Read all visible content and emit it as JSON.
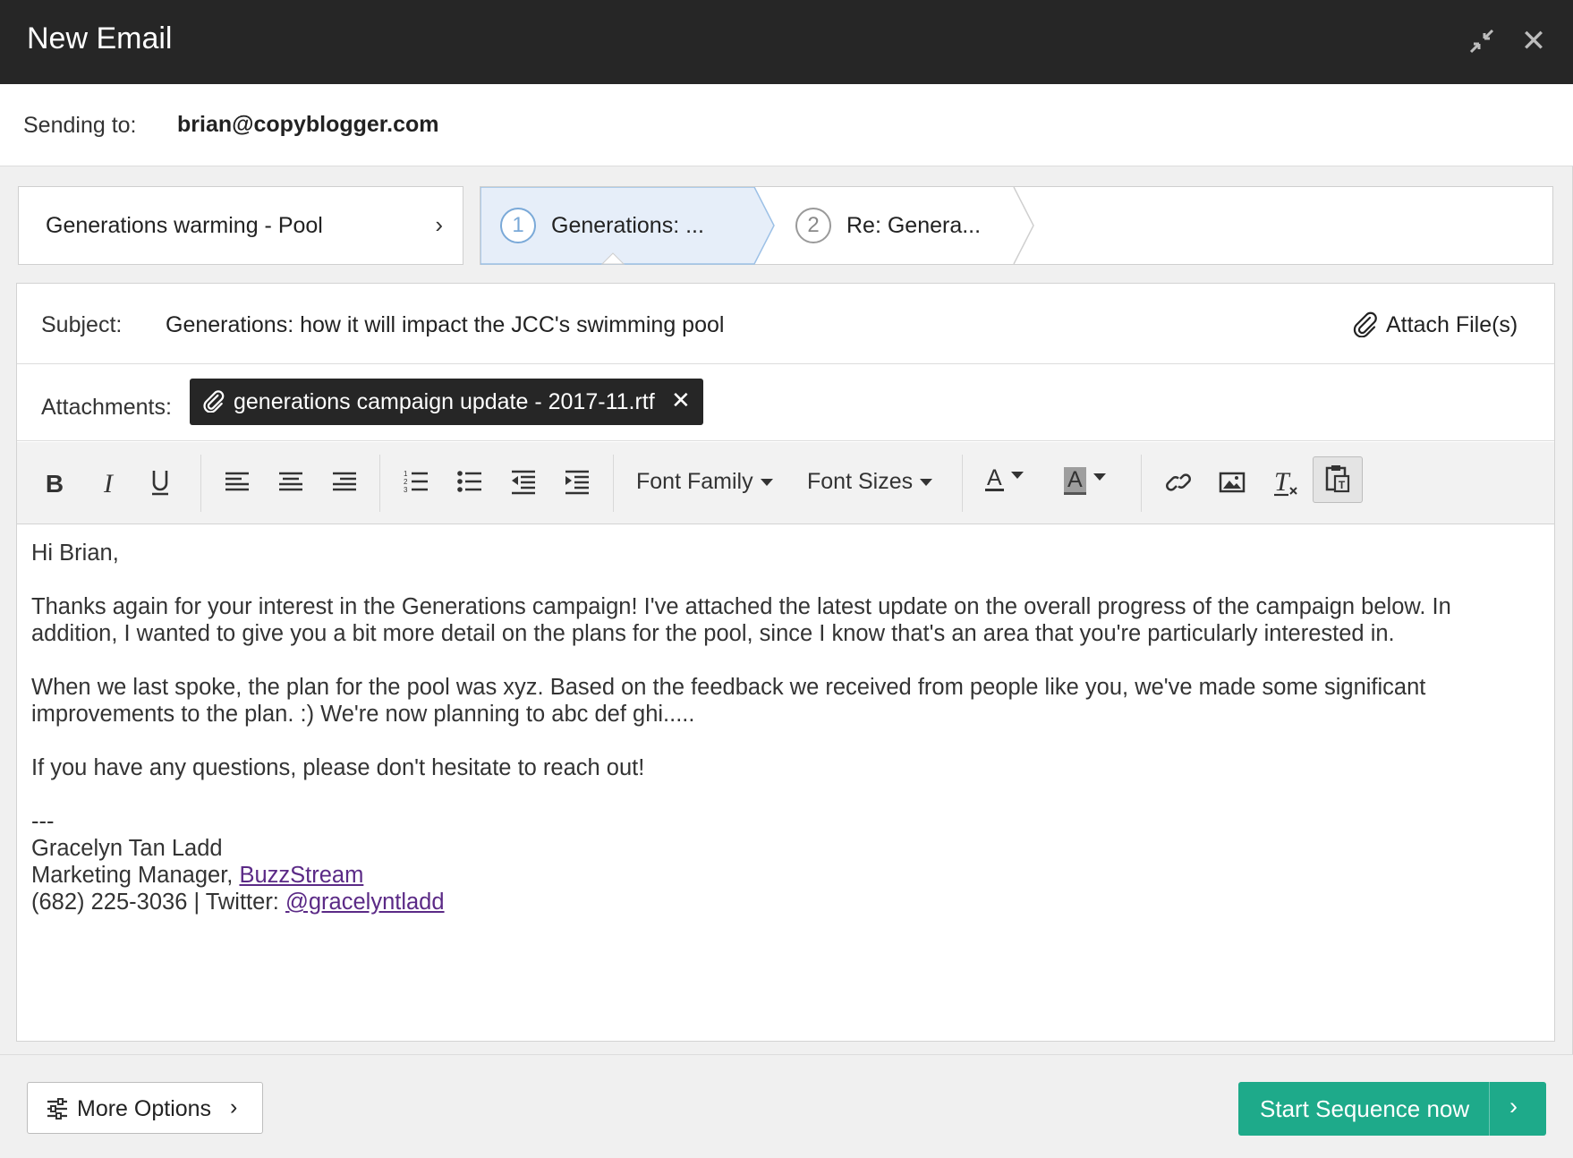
{
  "window": {
    "title": "New Email",
    "minimize_icon": "compress-arrows-icon",
    "close_icon": "close-icon",
    "close_glyph": "✕"
  },
  "recipient": {
    "label": "Sending to:",
    "email": "brian@copyblogger.com"
  },
  "sequence": {
    "template_label": "Generations warming - Pool",
    "template_chevron": "›",
    "steps": [
      {
        "number": "1",
        "label": "Generations: ...",
        "active": true
      },
      {
        "number": "2",
        "label": "Re: Genera...",
        "active": false
      }
    ]
  },
  "subject": {
    "label": "Subject:",
    "value": "Generations: how it will impact the JCC's swimming pool",
    "attach_label": "Attach File(s)"
  },
  "attachments": {
    "label": "Attachments:",
    "files": [
      {
        "name": "generations campaign update - 2017-11.rtf",
        "remove": "✕"
      }
    ]
  },
  "toolbar": {
    "font_family": "Font Family",
    "font_sizes": "Font Sizes",
    "text_color_glyph": "A",
    "bg_color_glyph": "A",
    "icons": [
      "bold-icon",
      "italic-icon",
      "underline-icon",
      "align-left-icon",
      "align-center-icon",
      "align-right-icon",
      "ordered-list-icon",
      "unordered-list-icon",
      "outdent-icon",
      "indent-icon",
      "text-color-icon",
      "background-color-icon",
      "link-icon",
      "image-icon",
      "clear-formatting-icon",
      "paste-text-icon"
    ]
  },
  "body": {
    "greeting": "Hi Brian,",
    "para1": "Thanks again for your interest in the Generations campaign! I've attached the latest update on the overall progress of the campaign below. In addition, I wanted to give you a bit more detail on the plans for the pool, since I know that's an area that you're particularly interested in.",
    "para2": "When we last spoke, the plan for the pool was xyz. Based on the feedback we received from people like you, we've made some significant improvements to the plan. :) We're now planning to abc def ghi.....",
    "para3": "If you have any questions, please don't hesitate to reach out!",
    "sig_sep": "---",
    "sig_name": "Gracelyn Tan Ladd",
    "sig_title_prefix": "Marketing Manager, ",
    "sig_company_link": "BuzzStream",
    "sig_phone_prefix": "(682) 225-3036 | Twitter: ",
    "sig_twitter_link": "@gracelyntladd",
    "link_color": "#5b2a86"
  },
  "footer": {
    "more_options": "More Options",
    "more_chevron": "›",
    "start_label": "Start Sequence now",
    "start_chevron": "›",
    "accent_color": "#1eaa8a"
  }
}
